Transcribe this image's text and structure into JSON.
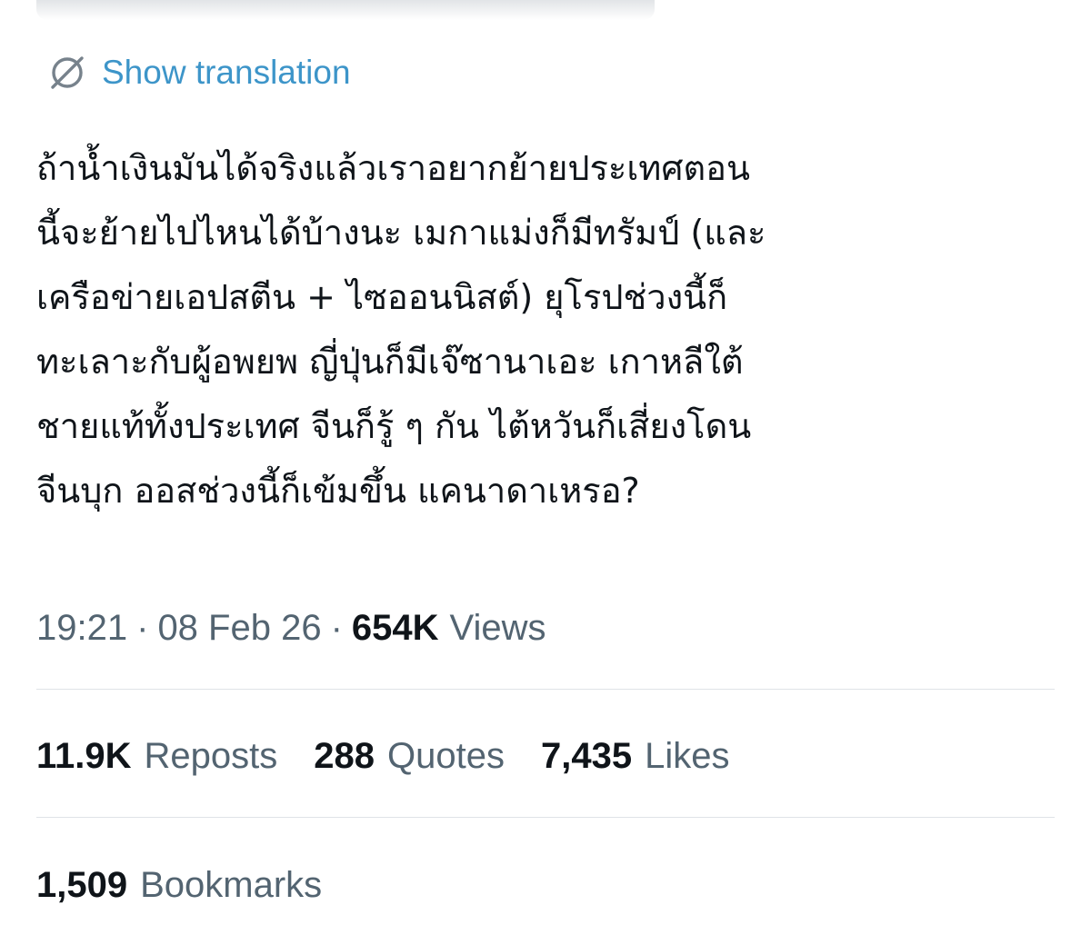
{
  "translation": {
    "label": "Show translation",
    "icon": "globe-translate-icon",
    "color": "#3d95c9"
  },
  "tweet": {
    "lines": [
      "ถ้าน้ำเงินมันได้จริงแล้วเราอยากย้ายประเทศตอน",
      "นี้จะย้ายไปไหนได้บ้างนะ เมกาแม่งก็มีทรัมป์ (และ",
      "เครือข่ายเอปสตีน + ไซออนนิสต์) ยุโรปช่วงนี้ก็",
      "ทะเลาะกับผู้อพยพ ญี่ปุ่นก็มีเจ๊ซานาเอะ เกาหลีใต้",
      "ชายแท้ทั้งประเทศ จีนก็รู้ ๆ กัน ไต้หวันก็เสี่ยงโดน",
      "จีนบุก ออสช่วงนี้ก็เข้มขึ้น แคนาดาเหรอ?"
    ]
  },
  "meta": {
    "time": "19:21",
    "separator": "·",
    "date": "08 Feb 26",
    "views_count": "654K",
    "views_label": "Views"
  },
  "stats": {
    "reposts_count": "11.9K",
    "reposts_label": "Reposts",
    "quotes_count": "288",
    "quotes_label": "Quotes",
    "likes_count": "7,435",
    "likes_label": "Likes",
    "bookmarks_count": "1,509",
    "bookmarks_label": "Bookmarks"
  }
}
